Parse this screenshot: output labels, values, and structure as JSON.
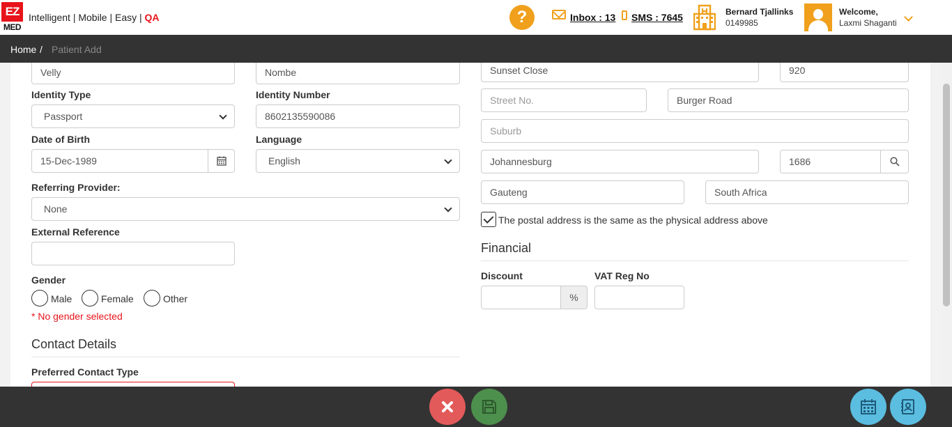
{
  "header": {
    "logo_top": "EZ",
    "logo_bottom": "MED",
    "tagline": "Intelligent | Mobile | Easy |",
    "env": "QA",
    "help": "?",
    "inbox": "Inbox : 13",
    "sms": "SMS : 7645",
    "practice_name": "Bernard Tjallinks",
    "practice_number": "0149985",
    "welcome": "Welcome,",
    "user_name": "Laxmi Shaganti"
  },
  "breadcrumb": {
    "home": "Home",
    "separator": "/",
    "current": "Patient Add"
  },
  "left": {
    "first_name": "Velly",
    "last_name": "Nombe",
    "identity_type_label": "Identity Type",
    "identity_type": "Passport",
    "identity_number_label": "Identity Number",
    "identity_number": "8602135590086",
    "dob_label": "Date of Birth",
    "dob": "15-Dec-1989",
    "language_label": "Language",
    "language": "English",
    "referring_label": "Referring Provider:",
    "referring": "None",
    "external_ref_label": "External Reference",
    "external_ref": "",
    "gender_label": "Gender",
    "gender_options": [
      "Male",
      "Female",
      "Other"
    ],
    "gender_error": "* No gender selected",
    "contact_title": "Contact Details",
    "preferred_contact_label": "Preferred Contact Type"
  },
  "right": {
    "street_name": "Sunset Close",
    "building_no": "920",
    "street_no_placeholder": "Street No.",
    "street": "Burger Road",
    "suburb_placeholder": "Suburb",
    "city": "Johannesburg",
    "postal_code": "1686",
    "province": "Gauteng",
    "country": "South Africa",
    "postal_same_label": "The postal address is the same as the physical address above",
    "financial_title": "Financial",
    "discount_label": "Discount",
    "discount_unit": "%",
    "vat_label": "VAT Reg No"
  },
  "colors": {
    "accent": "#f0a01c",
    "brand_red": "#e8141b",
    "bar": "#333333",
    "cancel": "#e35a5a",
    "save": "#4d8f4d",
    "fab_blue": "#5bbde0"
  }
}
